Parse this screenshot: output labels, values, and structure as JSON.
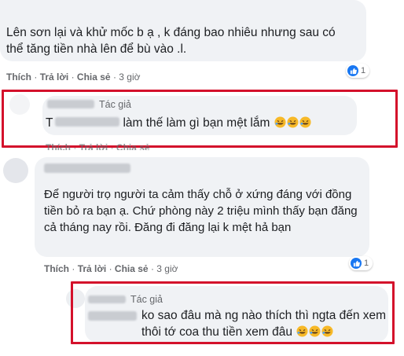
{
  "comment1": {
    "text": "Lên sơn lại và khử mốc b ạ , k đáng bao nhiêu nhưng sau có thể tăng tiền nhà lên để bù vào .l.",
    "actions": {
      "like": "Thích",
      "reply": "Trả lời",
      "share": "Chia sẻ",
      "sep": "·",
      "time": "3 giờ"
    },
    "like_count": "1"
  },
  "reply1": {
    "author_badge": "Tác giả",
    "prefix": "T",
    "text": "làm thế làm gì bạn mệt lắm",
    "emoji_icon": "rolling-laughing-emoji",
    "actions": {
      "like": "Thích",
      "reply": "Trả lời",
      "share": "Chia sẻ",
      "sep": "·"
    }
  },
  "comment2": {
    "text": "Để người trọ người ta cảm thấy chỗ ở xứng đáng với đồng tiền bỏ ra bạn ạ. Chứ phòng này 2 triệu mình thấy bạn đăng cả tháng nay rồi. Đăng đi đăng lại k mệt hả bạn",
    "actions": {
      "like": "Thích",
      "reply": "Trả lời",
      "share": "Chia sẻ",
      "sep": "·",
      "time": "3 giờ"
    },
    "like_count": "1"
  },
  "reply2": {
    "author_badge": "Tác giả",
    "text": "ko sao đâu mà ng nào thích thì ngta đến xem thôi tớ coa thu tiền xem đâu",
    "emoji_icon": "rolling-laughing-emoji"
  },
  "colors": {
    "highlight": "#d4112b",
    "like_blue": "#1877f2",
    "bubble": "#f0f2f5"
  }
}
